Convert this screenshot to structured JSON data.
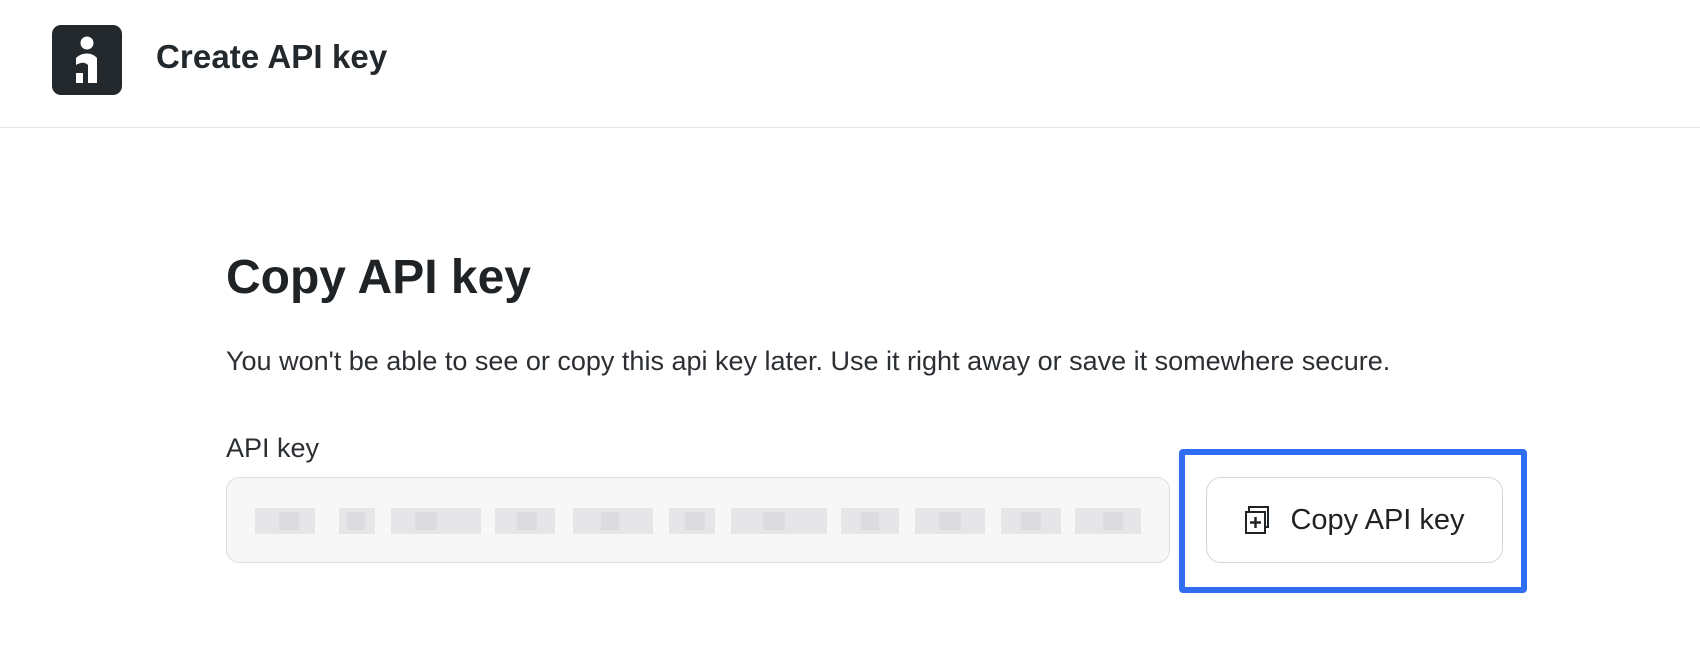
{
  "header": {
    "logo_icon": "brand-logo-icon",
    "title": "Create API key"
  },
  "main": {
    "heading": "Copy API key",
    "description": "You won't be able to see or copy this api key later. Use it right away or save it somewhere secure.",
    "api_key_field": {
      "label": "API key",
      "value": "",
      "obscured": true
    },
    "copy_button": {
      "icon": "copy-icon",
      "label": "Copy API key",
      "highlighted": true,
      "highlight_color": "#2f6ef2"
    }
  },
  "colors": {
    "logo_bg": "#22282b",
    "text": "#1f2326",
    "input_bg": "#f7f7f8",
    "highlight": "#2f6ef2"
  }
}
